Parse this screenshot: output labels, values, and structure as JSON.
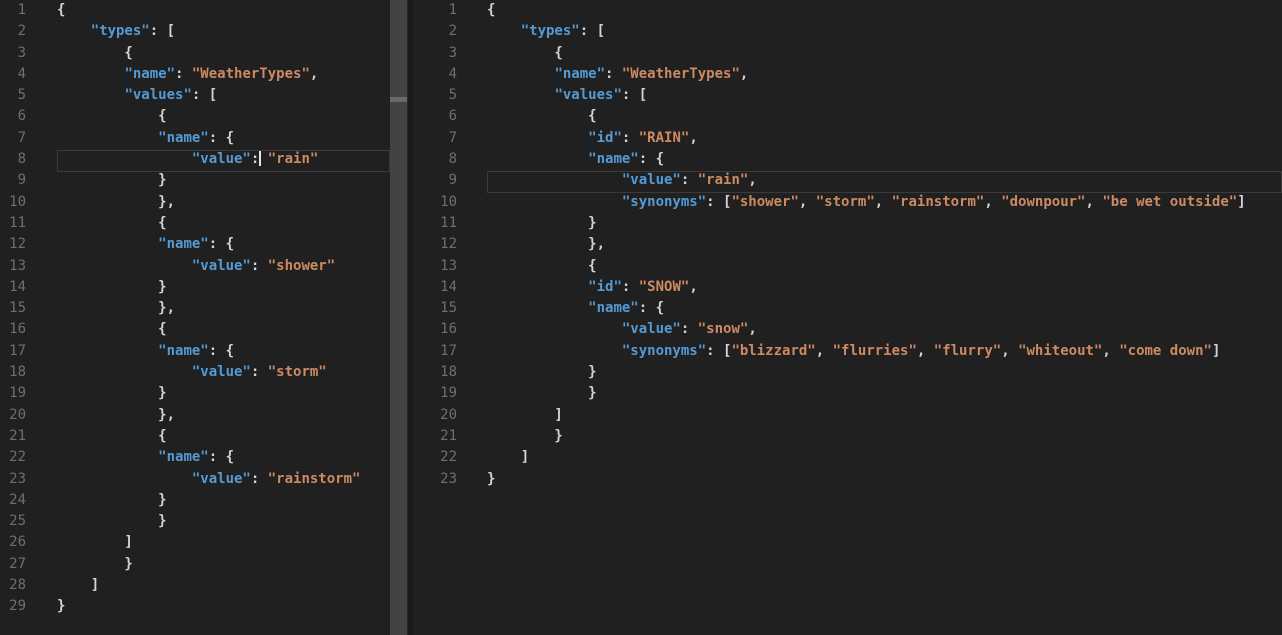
{
  "app": {
    "description": "split-view-code-editor-json-diff",
    "language": "JSON"
  },
  "colors": {
    "background": "#202021",
    "key": "#549bd5",
    "string": "#ce8a62",
    "punctuation": "#d4d4d4",
    "line_number": "#6d6f71",
    "current_line_border": "#3a3a3c",
    "caret": "#e3e3e3",
    "scrollbar_thumb": "#434346",
    "scrollbar_marker": "#696a6c",
    "divider": "#1a1a1c"
  },
  "left_pane": {
    "current_line": 8,
    "line_count": 29,
    "lines": [
      {
        "n": 1,
        "tokens": [
          [
            "p",
            "{"
          ]
        ]
      },
      {
        "n": 2,
        "tokens": [
          [
            "p",
            "    "
          ],
          [
            "k",
            "\"types\""
          ],
          [
            "p",
            ": ["
          ]
        ]
      },
      {
        "n": 3,
        "tokens": [
          [
            "p",
            "        {"
          ]
        ]
      },
      {
        "n": 4,
        "tokens": [
          [
            "p",
            "        "
          ],
          [
            "k",
            "\"name\""
          ],
          [
            "p",
            ": "
          ],
          [
            "s",
            "\"WeatherTypes\""
          ],
          [
            "p",
            ","
          ]
        ]
      },
      {
        "n": 5,
        "tokens": [
          [
            "p",
            "        "
          ],
          [
            "k",
            "\"values\""
          ],
          [
            "p",
            ": ["
          ]
        ]
      },
      {
        "n": 6,
        "tokens": [
          [
            "p",
            "            {"
          ]
        ]
      },
      {
        "n": 7,
        "tokens": [
          [
            "p",
            "            "
          ],
          [
            "k",
            "\"name\""
          ],
          [
            "p",
            ": {"
          ]
        ]
      },
      {
        "n": 8,
        "tokens": [
          [
            "p",
            "                "
          ],
          [
            "k",
            "\"value\""
          ],
          [
            "p",
            ":"
          ],
          [
            "c",
            ""
          ],
          [
            "p",
            " "
          ],
          [
            "s",
            "\"rain\""
          ]
        ]
      },
      {
        "n": 9,
        "tokens": [
          [
            "p",
            "            }"
          ]
        ]
      },
      {
        "n": 10,
        "tokens": [
          [
            "p",
            "            },"
          ]
        ]
      },
      {
        "n": 11,
        "tokens": [
          [
            "p",
            "            {"
          ]
        ]
      },
      {
        "n": 12,
        "tokens": [
          [
            "p",
            "            "
          ],
          [
            "k",
            "\"name\""
          ],
          [
            "p",
            ": {"
          ]
        ]
      },
      {
        "n": 13,
        "tokens": [
          [
            "p",
            "                "
          ],
          [
            "k",
            "\"value\""
          ],
          [
            "p",
            ": "
          ],
          [
            "s",
            "\"shower\""
          ]
        ]
      },
      {
        "n": 14,
        "tokens": [
          [
            "p",
            "            }"
          ]
        ]
      },
      {
        "n": 15,
        "tokens": [
          [
            "p",
            "            },"
          ]
        ]
      },
      {
        "n": 16,
        "tokens": [
          [
            "p",
            "            {"
          ]
        ]
      },
      {
        "n": 17,
        "tokens": [
          [
            "p",
            "            "
          ],
          [
            "k",
            "\"name\""
          ],
          [
            "p",
            ": {"
          ]
        ]
      },
      {
        "n": 18,
        "tokens": [
          [
            "p",
            "                "
          ],
          [
            "k",
            "\"value\""
          ],
          [
            "p",
            ": "
          ],
          [
            "s",
            "\"storm\""
          ]
        ]
      },
      {
        "n": 19,
        "tokens": [
          [
            "p",
            "            }"
          ]
        ]
      },
      {
        "n": 20,
        "tokens": [
          [
            "p",
            "            },"
          ]
        ]
      },
      {
        "n": 21,
        "tokens": [
          [
            "p",
            "            {"
          ]
        ]
      },
      {
        "n": 22,
        "tokens": [
          [
            "p",
            "            "
          ],
          [
            "k",
            "\"name\""
          ],
          [
            "p",
            ": {"
          ]
        ]
      },
      {
        "n": 23,
        "tokens": [
          [
            "p",
            "                "
          ],
          [
            "k",
            "\"value\""
          ],
          [
            "p",
            ": "
          ],
          [
            "s",
            "\"rainstorm\""
          ]
        ]
      },
      {
        "n": 24,
        "tokens": [
          [
            "p",
            "            }"
          ]
        ]
      },
      {
        "n": 25,
        "tokens": [
          [
            "p",
            "            }"
          ]
        ]
      },
      {
        "n": 26,
        "tokens": [
          [
            "p",
            "        ]"
          ]
        ]
      },
      {
        "n": 27,
        "tokens": [
          [
            "p",
            "        }"
          ]
        ]
      },
      {
        "n": 28,
        "tokens": [
          [
            "p",
            "    ]"
          ]
        ]
      },
      {
        "n": 29,
        "tokens": [
          [
            "p",
            "}"
          ]
        ]
      }
    ]
  },
  "right_pane": {
    "current_line": 9,
    "line_count": 23,
    "lines": [
      {
        "n": 1,
        "tokens": [
          [
            "p",
            "{"
          ]
        ]
      },
      {
        "n": 2,
        "tokens": [
          [
            "p",
            "    "
          ],
          [
            "k",
            "\"types\""
          ],
          [
            "p",
            ": ["
          ]
        ]
      },
      {
        "n": 3,
        "tokens": [
          [
            "p",
            "        {"
          ]
        ]
      },
      {
        "n": 4,
        "tokens": [
          [
            "p",
            "        "
          ],
          [
            "k",
            "\"name\""
          ],
          [
            "p",
            ": "
          ],
          [
            "s",
            "\"WeatherTypes\""
          ],
          [
            "p",
            ","
          ]
        ]
      },
      {
        "n": 5,
        "tokens": [
          [
            "p",
            "        "
          ],
          [
            "k",
            "\"values\""
          ],
          [
            "p",
            ": ["
          ]
        ]
      },
      {
        "n": 6,
        "tokens": [
          [
            "p",
            "            {"
          ]
        ]
      },
      {
        "n": 7,
        "tokens": [
          [
            "p",
            "            "
          ],
          [
            "k",
            "\"id\""
          ],
          [
            "p",
            ": "
          ],
          [
            "s",
            "\"RAIN\""
          ],
          [
            "p",
            ","
          ]
        ]
      },
      {
        "n": 8,
        "tokens": [
          [
            "p",
            "            "
          ],
          [
            "k",
            "\"name\""
          ],
          [
            "p",
            ": {"
          ]
        ]
      },
      {
        "n": 9,
        "tokens": [
          [
            "p",
            "                "
          ],
          [
            "k",
            "\"value\""
          ],
          [
            "p",
            ": "
          ],
          [
            "s",
            "\"rain\""
          ],
          [
            "p",
            ","
          ]
        ]
      },
      {
        "n": 10,
        "tokens": [
          [
            "p",
            "                "
          ],
          [
            "k",
            "\"synonyms\""
          ],
          [
            "p",
            ": ["
          ],
          [
            "s",
            "\"shower\""
          ],
          [
            "p",
            ", "
          ],
          [
            "s",
            "\"storm\""
          ],
          [
            "p",
            ", "
          ],
          [
            "s",
            "\"rainstorm\""
          ],
          [
            "p",
            ", "
          ],
          [
            "s",
            "\"downpour\""
          ],
          [
            "p",
            ", "
          ],
          [
            "s",
            "\"be wet outside\""
          ],
          [
            "p",
            "]"
          ]
        ]
      },
      {
        "n": 11,
        "tokens": [
          [
            "p",
            "            }"
          ]
        ]
      },
      {
        "n": 12,
        "tokens": [
          [
            "p",
            "            },"
          ]
        ]
      },
      {
        "n": 13,
        "tokens": [
          [
            "p",
            "            {"
          ]
        ]
      },
      {
        "n": 14,
        "tokens": [
          [
            "p",
            "            "
          ],
          [
            "k",
            "\"id\""
          ],
          [
            "p",
            ": "
          ],
          [
            "s",
            "\"SNOW\""
          ],
          [
            "p",
            ","
          ]
        ]
      },
      {
        "n": 15,
        "tokens": [
          [
            "p",
            "            "
          ],
          [
            "k",
            "\"name\""
          ],
          [
            "p",
            ": {"
          ]
        ]
      },
      {
        "n": 16,
        "tokens": [
          [
            "p",
            "                "
          ],
          [
            "k",
            "\"value\""
          ],
          [
            "p",
            ": "
          ],
          [
            "s",
            "\"snow\""
          ],
          [
            "p",
            ","
          ]
        ]
      },
      {
        "n": 17,
        "tokens": [
          [
            "p",
            "                "
          ],
          [
            "k",
            "\"synonyms\""
          ],
          [
            "p",
            ": ["
          ],
          [
            "s",
            "\"blizzard\""
          ],
          [
            "p",
            ", "
          ],
          [
            "s",
            "\"flurries\""
          ],
          [
            "p",
            ", "
          ],
          [
            "s",
            "\"flurry\""
          ],
          [
            "p",
            ", "
          ],
          [
            "s",
            "\"whiteout\""
          ],
          [
            "p",
            ", "
          ],
          [
            "s",
            "\"come down\""
          ],
          [
            "p",
            "]"
          ]
        ]
      },
      {
        "n": 18,
        "tokens": [
          [
            "p",
            "            }"
          ]
        ]
      },
      {
        "n": 19,
        "tokens": [
          [
            "p",
            "            }"
          ]
        ]
      },
      {
        "n": 20,
        "tokens": [
          [
            "p",
            "        ]"
          ]
        ]
      },
      {
        "n": 21,
        "tokens": [
          [
            "p",
            "        }"
          ]
        ]
      },
      {
        "n": 22,
        "tokens": [
          [
            "p",
            "    ]"
          ]
        ]
      },
      {
        "n": 23,
        "tokens": [
          [
            "p",
            "}"
          ]
        ]
      }
    ]
  }
}
